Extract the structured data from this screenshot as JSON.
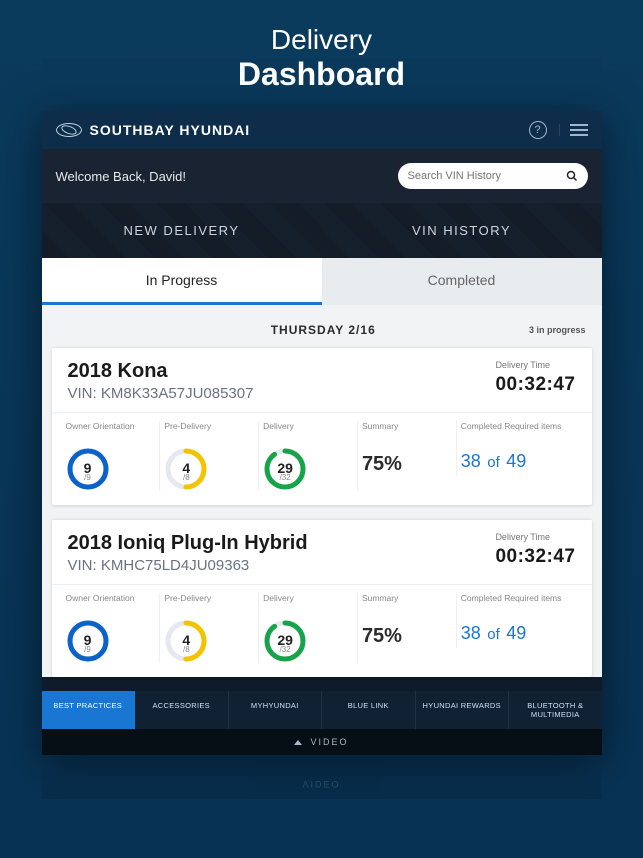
{
  "promo": {
    "line1": "Delivery",
    "line2": "Dashboard"
  },
  "header": {
    "dealer": "SOUTHBAY HYUNDAI"
  },
  "welcome": "Welcome Back, David!",
  "search": {
    "placeholder": "Search VIN History"
  },
  "mainTabs": {
    "left": "NEW DELIVERY",
    "right": "VIN HISTORY"
  },
  "subTabs": {
    "active": "In Progress",
    "other": "Completed"
  },
  "dateHeader": {
    "label": "THURSDAY 2/16",
    "count": "3 in progress"
  },
  "metricsLabels": {
    "owner": "Owner Orientation",
    "pre": "Pre-Delivery",
    "delivery": "Delivery",
    "summary": "Summary",
    "completed": "Completed Required items",
    "deliveryTime": "Delivery Time"
  },
  "cards": [
    {
      "title": "2018 Kona",
      "vinLabel": "VIN:",
      "vin": "KM8K33A57JU085307",
      "time": "00:32:47",
      "owner": {
        "num": "9",
        "den": "/9",
        "pct": 100,
        "color": "#0b63c9"
      },
      "pre": {
        "num": "4",
        "den": "/8",
        "pct": 50,
        "color": "#f2c400"
      },
      "delivery": {
        "num": "29",
        "den": "/32",
        "pct": 90,
        "color": "#16a34a"
      },
      "summary": "75%",
      "compA": "38",
      "compOf": "of",
      "compB": "49"
    },
    {
      "title": "2018 Ioniq Plug-In Hybrid",
      "vinLabel": "VIN:",
      "vin": "KMHC75LD4JU09363",
      "time": "00:32:47",
      "owner": {
        "num": "9",
        "den": "/9",
        "pct": 100,
        "color": "#0b63c9"
      },
      "pre": {
        "num": "4",
        "den": "/8",
        "pct": 50,
        "color": "#f2c400"
      },
      "delivery": {
        "num": "29",
        "den": "/32",
        "pct": 90,
        "color": "#16a34a"
      },
      "summary": "75%",
      "compA": "38",
      "compOf": "of",
      "compB": "49"
    }
  ],
  "bottomNav": {
    "items": [
      "BEST PRACTICES",
      "ACCESSORIES",
      "MYHYUNDAI",
      "BLUE LINK",
      "HYUNDAI REWARDS",
      "BLUETOOTH & MULTIMEDIA"
    ]
  },
  "video": "VIDEO"
}
